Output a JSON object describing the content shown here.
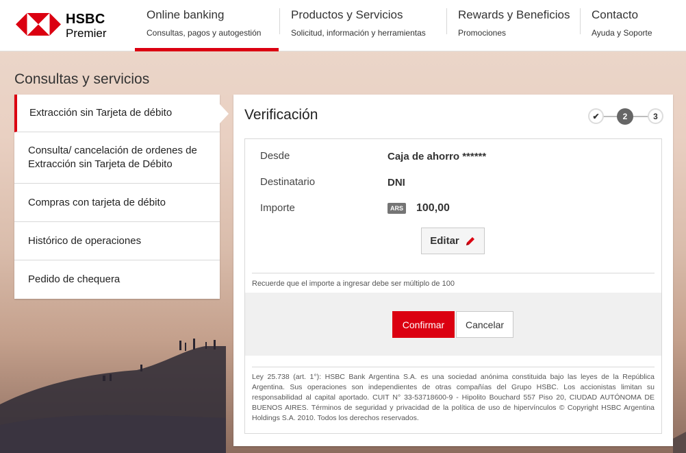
{
  "brand": {
    "name": "HSBC",
    "tier": "Premier",
    "logo": "hsbc-hexagon-logo"
  },
  "nav": [
    {
      "title": "Online banking",
      "subtitle": "Consultas, pagos y autogestión",
      "active": true
    },
    {
      "title": "Productos y Servicios",
      "subtitle": "Solicitud, información y herramientas",
      "active": false
    },
    {
      "title": "Rewards y Beneficios",
      "subtitle": "Promociones",
      "active": false
    },
    {
      "title": "Contacto",
      "subtitle": "Ayuda y Soporte",
      "active": false
    }
  ],
  "page_title": "Consultas y servicios",
  "sidebar": {
    "items": [
      {
        "label": "Extracción sin Tarjeta de débito",
        "active": true
      },
      {
        "label": "Consulta/ cancelación de ordenes de Extracción sin Tarjeta de Débito",
        "active": false
      },
      {
        "label": "Compras con tarjeta de débito",
        "active": false
      },
      {
        "label": "Histórico de operaciones",
        "active": false
      },
      {
        "label": "Pedido de chequera",
        "active": false
      }
    ]
  },
  "main": {
    "title": "Verificación",
    "steps": [
      {
        "label": "✔",
        "state": "done"
      },
      {
        "label": "2",
        "state": "current"
      },
      {
        "label": "3",
        "state": "todo"
      }
    ],
    "fields": {
      "desde_label": "Desde",
      "desde_value": "Caja de ahorro ******",
      "destinatario_label": "Destinatario",
      "destinatario_value": "DNI",
      "importe_label": "Importe",
      "currency": "ARS",
      "importe_value": "100,00"
    },
    "edit_label": "Editar",
    "note": "Recuerde que el importe a ingresar debe ser múltiplo de 100",
    "confirm_label": "Confirmar",
    "cancel_label": "Cancelar",
    "legal": "Ley 25.738 (art. 1°): HSBC Bank Argentina S.A. es una sociedad anónima constituida bajo las leyes de la República Argentina. Sus operaciones son independientes de otras compañías del Grupo HSBC. Los accionistas limitan su responsabilidad al capital aportado. CUIT N° 33-53718600-9 - Hipolito Bouchard 557 Piso 20, CIUDAD AUTÓNOMA DE BUENOS AIRES. Términos de seguridad y privacidad de la política de uso de hipervínculos © Copyright HSBC Argentina Holdings S.A. 2010. Todos los derechos reservados."
  },
  "colors": {
    "brand_red": "#db0011",
    "step_current": "#666666"
  }
}
